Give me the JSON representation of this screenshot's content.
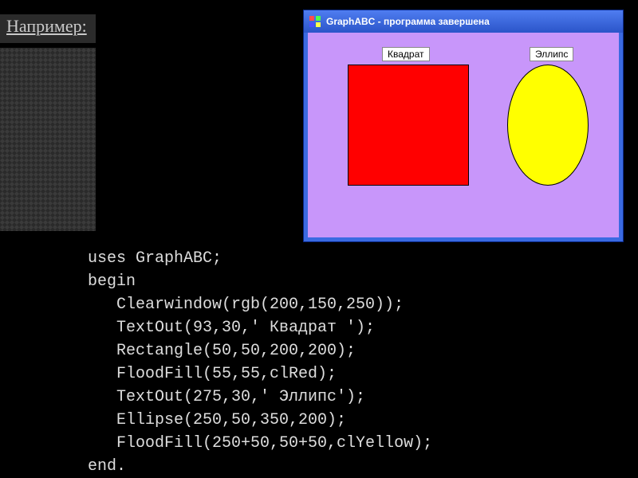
{
  "heading": "Например:",
  "window": {
    "title": "GraphABC  - программа завершена",
    "label_square": "Квадрат",
    "label_ellipse": "Эллипс"
  },
  "code": "uses GraphABC;\nbegin\n   Clearwindow(rgb(200,150,250));\n   TextOut(93,30,' Квадрат ');\n   Rectangle(50,50,200,200);\n   FloodFill(55,55,clRed);\n   TextOut(275,30,' Эллипс');\n   Ellipse(250,50,350,200);\n   FloodFill(250+50,50+50,clYellow);\nend.",
  "colors": {
    "canvas_bg": "#c896fa",
    "square_fill": "#ff0000",
    "ellipse_fill": "#ffff00"
  }
}
